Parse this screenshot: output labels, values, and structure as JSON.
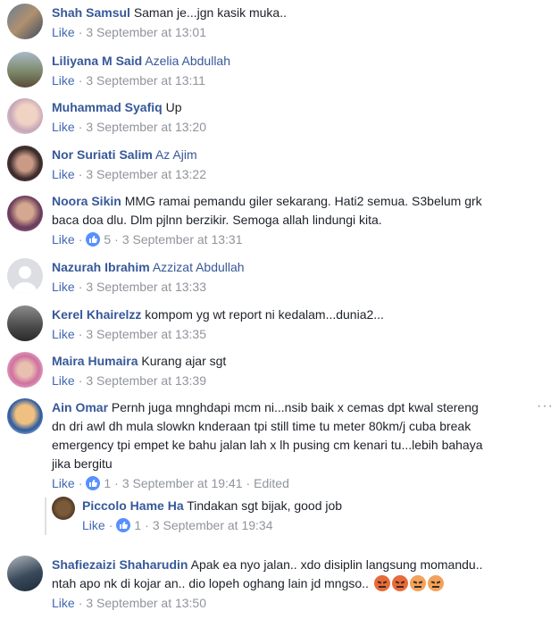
{
  "comments": [
    {
      "name": "Shah Samsul",
      "tag": "",
      "text": "Saman je...jgn kasik muka..",
      "like": "Like",
      "time": "3 September at 13:01"
    },
    {
      "name": "Liliyana M Said",
      "tag": "Azelia Abdullah",
      "text": "",
      "like": "Like",
      "time": "3 September at 13:11"
    },
    {
      "name": "Muhammad Syafiq",
      "tag": "",
      "text": "Up",
      "like": "Like",
      "time": "3 September at 13:20"
    },
    {
      "name": "Nor Suriati Salim",
      "tag": "Az Ajim",
      "text": "",
      "like": "Like",
      "time": "3 September at 13:22"
    },
    {
      "name": "Noora Sikin",
      "tag": "",
      "text": "MMG ramai pemandu giler sekarang. Hati2 semua. S3belum grk",
      "text2": "baca doa dlu. Dlm pjlnn berzikir. Semoga allah lindungi kita.",
      "like": "Like",
      "reactions": "5",
      "time": "3 September at 13:31"
    },
    {
      "name": "Nazurah Ibrahim",
      "tag": "Azzizat Abdullah",
      "text": "",
      "like": "Like",
      "time": "3 September at 13:33"
    },
    {
      "name": "Kerel Khairelzz",
      "tag": "",
      "text": "kompom yg wt report ni kedalam...dunia2...",
      "like": "Like",
      "time": "3 September at 13:35"
    },
    {
      "name": "Maira Humaira",
      "tag": "",
      "text": "Kurang ajar sgt",
      "like": "Like",
      "time": "3 September at 13:39"
    },
    {
      "name": "Ain Omar",
      "tag": "",
      "text": "Pernh juga mnghdapi mcm ni...nsib baik x cemas dpt kwal stereng",
      "text2": "dn dri awl dh mula slowkn knderaan tpi still time tu meter 80km/j cuba break",
      "text3": "emergency tpi empet ke bahu jalan lah x lh pusing cm kenari tu...lebih bahaya",
      "text4": "jika bergitu",
      "like": "Like",
      "reactions": "1",
      "time": "3 September at 19:41",
      "edited": "Edited"
    },
    {
      "name": "Piccolo Hame Ha",
      "tag": "",
      "text": "Tindakan sgt bijak, good job",
      "like": "Like",
      "reactions": "1",
      "time": "3 September at 19:34"
    },
    {
      "name": "Shafiezaizi Shaharudin",
      "tag": "",
      "text": "Apak ea nyo jalan.. xdo disiplin langsung momandu..",
      "text2": "ntah apo nk di kojar an.. dio lopeh oghang lain jd mngso..",
      "like": "Like",
      "time": "3 September at 13:50"
    }
  ],
  "more_icon": "···"
}
